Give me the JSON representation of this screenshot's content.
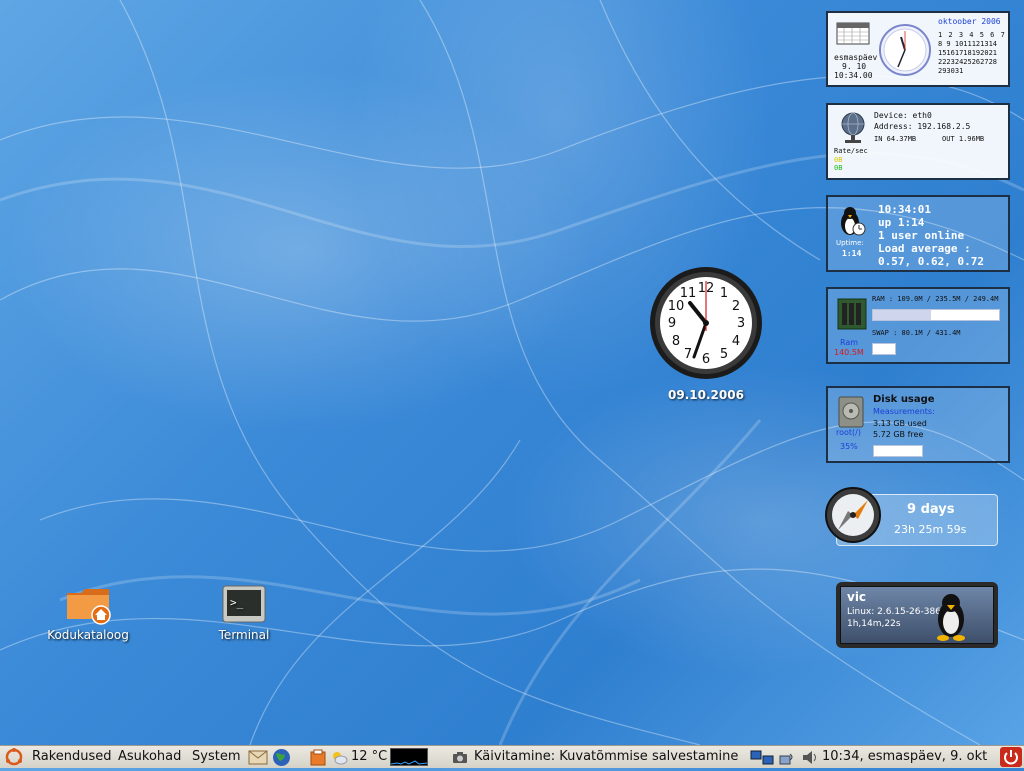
{
  "datetime_widget": {
    "weekday": "esmaspäev",
    "date": "9. 10",
    "time": "10:34.00",
    "month_title": "oktoober 2006",
    "calendar_rows": [
      "1 2 3 4 5 6 7",
      "8 9 1011121314",
      "15161718192021",
      "22232425262728",
      "293031"
    ]
  },
  "network_widget": {
    "device": "Device: eth0",
    "address": "Address: 192.168.2.5",
    "in": "IN 64.37MB",
    "out": "OUT 1.96MB",
    "rate_label": "Rate/sec",
    "rate_in": "0B",
    "rate_out": "0B"
  },
  "uptime_widget": {
    "time": "10:34:01",
    "up": "up 1:14",
    "users": "1 user online",
    "load_label": "Load average :",
    "load_values": "0.57, 0.62, 0.72",
    "uptime_label": "Uptime:",
    "uptime_value": "1:14"
  },
  "ram_widget": {
    "ram_text": "RAM : 109.0M / 235.5M / 249.4M",
    "ram_fill": 0.46,
    "swap_text": "SWAP : 80.1M / 431.4M",
    "swap_fill": 0.19,
    "label": "Ram",
    "value": "140.5M"
  },
  "disk_widget": {
    "title": "Disk usage",
    "measurements": "Measurements:",
    "used": "3.13 GB used",
    "free": "5.72 GB free",
    "mount": "root(/)",
    "percent": "35%",
    "fill": 0.35
  },
  "days_widget": {
    "days": "9 days",
    "hms": "23h 25m 59s"
  },
  "user_widget": {
    "user": "vic",
    "kernel": "Linux: 2.6.15-26-386",
    "uptime": "1h,14m,22s"
  },
  "analog_clock": {
    "date": "09.10.2006"
  },
  "desktop_icons": {
    "home": "Kodukataloog",
    "terminal": "Terminal"
  },
  "taskbar": {
    "menu_apps": "Rakendused",
    "menu_places": "Asukohad",
    "menu_system": "System",
    "weather": "12 °C",
    "task": "Käivitamine: Kuvatõmmise salvestamine",
    "clock": "10:34, esmaspäev,  9. okt"
  },
  "colors": {
    "accent_blue": "#1b3fd6",
    "red": "#d81b1b",
    "yellow": "#d8c800",
    "green": "#1ab81a"
  }
}
